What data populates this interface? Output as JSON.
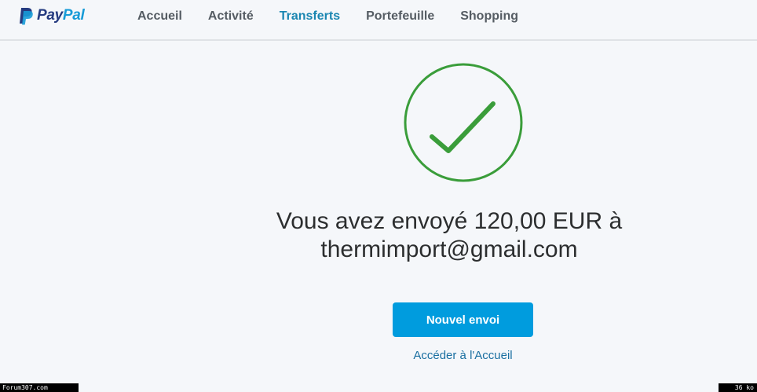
{
  "brand": {
    "logo_pay": "Pay",
    "logo_pal": "Pal",
    "logo_icon": "paypal-p-icon"
  },
  "nav": {
    "items": [
      {
        "label": "Accueil",
        "active": false
      },
      {
        "label": "Activité",
        "active": false
      },
      {
        "label": "Transferts",
        "active": true
      },
      {
        "label": "Portefeuille",
        "active": false
      },
      {
        "label": "Shopping",
        "active": false
      }
    ]
  },
  "confirmation": {
    "icon": "success-check-icon",
    "line1": "Vous avez envoyé 120,00 EUR à",
    "line2": "thermimport@gmail.com",
    "primary_button": "Nouvel envoi",
    "home_link": "Accéder à l'Accueil"
  },
  "watermark": {
    "left": "Forum307.com",
    "right": "36 ko"
  },
  "colors": {
    "accent": "#009cde",
    "active_nav": "#1a86b1",
    "success": "#3a9d3a",
    "background": "#f5f7fa"
  }
}
